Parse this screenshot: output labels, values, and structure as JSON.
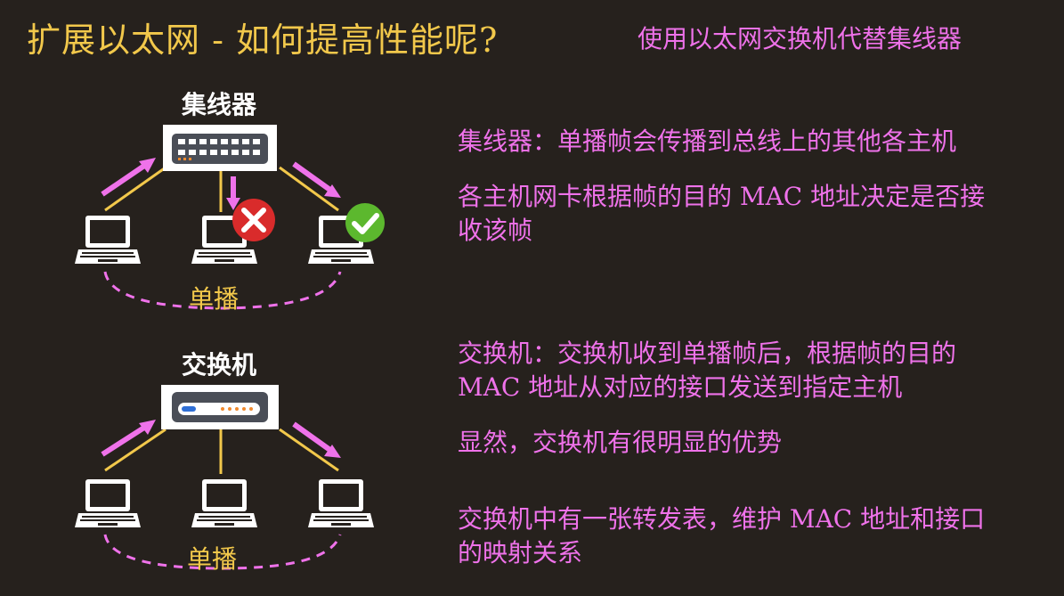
{
  "title": "扩展以太网 - 如何提高性能呢?",
  "subtitle": "使用以太网交换机代替集线器",
  "hub_section": {
    "device_label": "集线器",
    "unicast_label": "单播",
    "desc_1": "集线器：单播帧会传播到总线上的其他各主机",
    "desc_2": "各主机网卡根据帧的目的 MAC 地址决定是否接收该帧"
  },
  "switch_section": {
    "device_label": "交换机",
    "unicast_label": "单播",
    "desc_1": "交换机：交换机收到单播帧后，根据帧的目的 MAC 地址从对应的接口发送到指定主机",
    "desc_2": "显然，交换机有很明显的优势",
    "desc_3": "交换机中有一张转发表，维护 MAC 地址和接口的映射关系"
  },
  "colors": {
    "background": "#26211d",
    "title": "#f2c84b",
    "accent_pink": "#ef72ea",
    "link_yellow": "#f2c84b",
    "reject_red": "#d92b2b",
    "accept_green": "#5cb82e"
  },
  "icons": [
    "hub-icon",
    "switch-icon",
    "laptop-icon",
    "reject-icon",
    "accept-icon",
    "arrow-icon"
  ]
}
